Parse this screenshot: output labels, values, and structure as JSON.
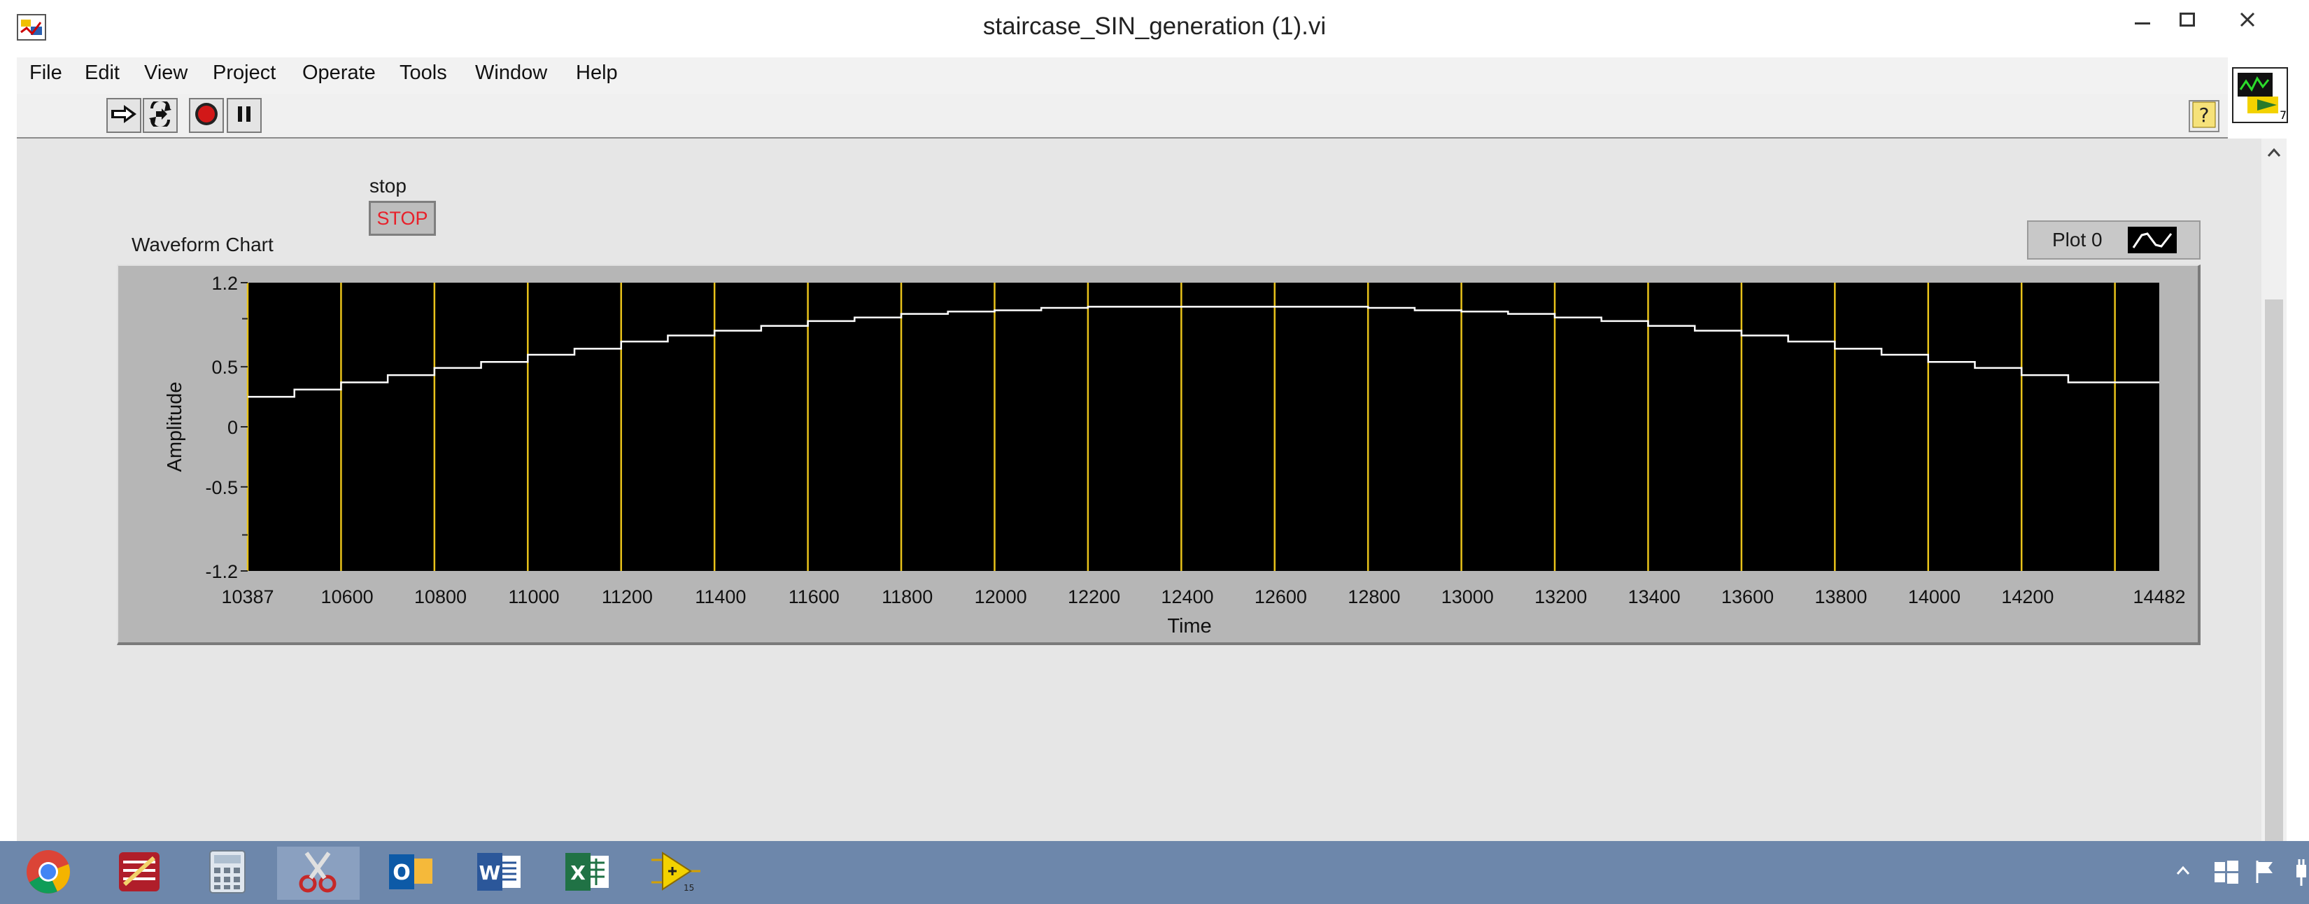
{
  "window": {
    "title": "staircase_SIN_generation (1).vi"
  },
  "menu": [
    "File",
    "Edit",
    "View",
    "Project",
    "Operate",
    "Tools",
    "Window",
    "Help"
  ],
  "toolbar": {
    "buttons": [
      "run-arrow-icon",
      "run-continuously-icon",
      "abort-icon",
      "pause-icon"
    ],
    "help": "?"
  },
  "vi_icon": {
    "badge": "7"
  },
  "stop_control": {
    "label": "stop",
    "button_text": "STOP",
    "text_color": "#e8202a"
  },
  "waveform_chart": {
    "label": "Waveform Chart",
    "legend": {
      "plot_name": "Plot 0"
    }
  },
  "chart_data": {
    "type": "line",
    "title": "Waveform Chart",
    "xlabel": "Time",
    "ylabel": "Amplitude",
    "xlim": [
      10387,
      14482
    ],
    "ylim": [
      -1.2,
      1.2
    ],
    "x_ticks": [
      "10387",
      "10600",
      "10800",
      "11000",
      "11200",
      "11400",
      "11600",
      "11800",
      "12000",
      "12200",
      "12400",
      "12600",
      "12800",
      "13000",
      "13200",
      "13400",
      "13600",
      "13800",
      "14000",
      "14200",
      "14482"
    ],
    "y_ticks": [
      "1.2",
      "0.5",
      "0",
      "-0.5",
      "-1.2"
    ],
    "background": "#000000",
    "trace_color": "#ffffff",
    "marker_color": "#e8c21a",
    "step_markers_x": [
      10387,
      10587,
      10787,
      10987,
      11187,
      11387,
      11587,
      11787,
      11987,
      12187,
      12387,
      12587,
      12787,
      12987,
      13187,
      13387,
      13587,
      13787,
      13987,
      14187,
      14387
    ],
    "series": [
      {
        "name": "Plot 0",
        "x": [
          10387,
          10487,
          10587,
          10687,
          10787,
          10887,
          10987,
          11087,
          11187,
          11287,
          11387,
          11487,
          11587,
          11687,
          11787,
          11887,
          11987,
          12087,
          12187,
          12287,
          12387,
          12487,
          12587,
          12687,
          12787,
          12887,
          12987,
          13087,
          13187,
          13287,
          13387,
          13487,
          13587,
          13687,
          13787,
          13887,
          13987,
          14087,
          14187,
          14287,
          14387
        ],
        "values": [
          0.25,
          0.31,
          0.37,
          0.43,
          0.49,
          0.54,
          0.6,
          0.65,
          0.71,
          0.76,
          0.8,
          0.84,
          0.88,
          0.91,
          0.94,
          0.96,
          0.97,
          0.99,
          1.0,
          1.0,
          1.0,
          1.0,
          1.0,
          1.0,
          0.99,
          0.97,
          0.96,
          0.94,
          0.91,
          0.88,
          0.84,
          0.8,
          0.76,
          0.71,
          0.65,
          0.6,
          0.54,
          0.49,
          0.43,
          0.37,
          0.37
        ]
      }
    ],
    "grid": false,
    "legend_position": "top-right"
  },
  "taskbar": {
    "apps": [
      "chrome-icon",
      "winrar-icon",
      "calculator-icon",
      "snipping-tool-icon",
      "outlook-icon",
      "word-icon",
      "excel-icon",
      "labview-icon"
    ]
  }
}
